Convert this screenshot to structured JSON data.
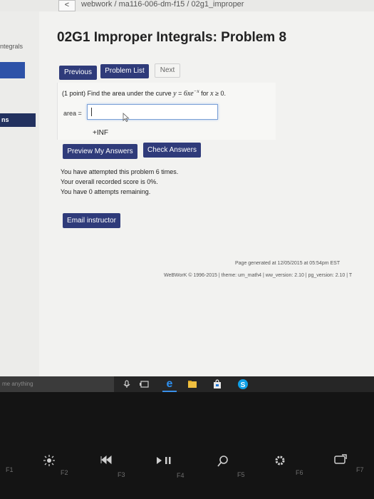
{
  "browser": {
    "back_glyph": "<",
    "breadcrumb": "webwork / ma116-006-dm-f15 / 02g1_improper"
  },
  "sidebar": {
    "top_label": "ntegrals",
    "button_label": "ns"
  },
  "page": {
    "title": "02G1 Improper Integrals: Problem 8"
  },
  "nav": {
    "previous": "Previous",
    "problem_list": "Problem List",
    "next": "Next"
  },
  "problem": {
    "points": "(1 point) Find the area under the curve",
    "equation_lhs": "y",
    "equals": "=",
    "equation_rhs": "6xe",
    "exponent": "−x",
    "for_text": "for",
    "condition_var": "x",
    "condition": "≥ 0.",
    "area_label": "area =",
    "answer_value": "",
    "preview_result": "+INF"
  },
  "actions": {
    "preview": "Preview My Answers",
    "check": "Check Answers",
    "email": "Email instructor"
  },
  "status": {
    "attempts": "You have attempted this problem 6 times.",
    "score": "Your overall recorded score is 0%.",
    "remaining": "You have 0 attempts remaining."
  },
  "footer": {
    "generated": "Page generated at 12/05/2015 at 05:54pm EST",
    "copyright": "WeBWorK © 1996-2015 | theme: um_math4 | ww_version: 2.10 | pg_version: 2.10 | T"
  },
  "taskbar": {
    "search_placeholder": "me anything"
  },
  "keyboard": {
    "keys": [
      "F1",
      "F2",
      "F3",
      "F4",
      "F5",
      "F6",
      "F7"
    ]
  }
}
